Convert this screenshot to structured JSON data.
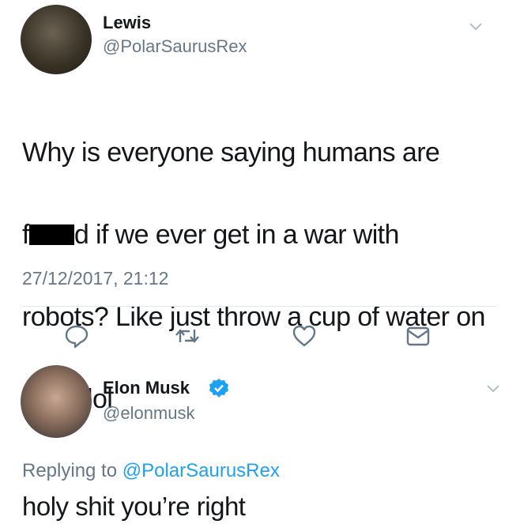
{
  "tweet1": {
    "display_name": "Lewis",
    "handle": "@PolarSaurusRex",
    "text_line1": "Why is everyone saying humans are",
    "text_line2_prefix": "f",
    "text_line2_suffix": "d if we ever get in a war with",
    "text_line3": "robots? Like just throw a cup of water on",
    "text_line4": "them lol",
    "timestamp": "27/12/2017, 21:12",
    "actions": [
      "reply-icon",
      "retweet-icon",
      "like-icon",
      "share-icon"
    ]
  },
  "tweet2": {
    "display_name": "Elon Musk",
    "handle": "@elonmusk",
    "verified": true,
    "replying_prefix": "Replying to",
    "replying_mention": "@PolarSaurusRex",
    "text": "holy shit you’re right"
  },
  "colors": {
    "text": "#14171a",
    "secondary": "#657786",
    "accent": "#1da1f2",
    "divider": "#e1e8ed"
  }
}
